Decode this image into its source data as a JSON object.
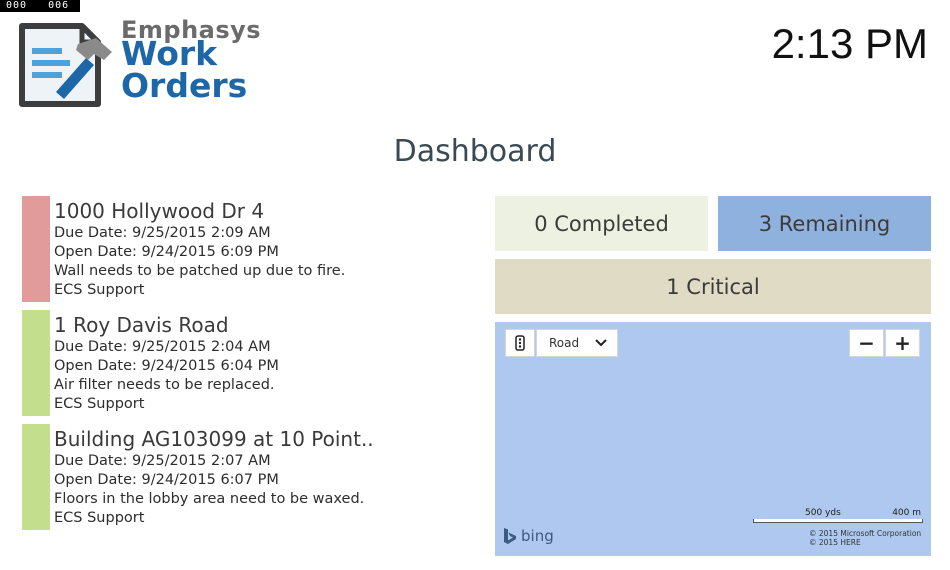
{
  "debug": {
    "left": "000",
    "right": "006"
  },
  "brand": {
    "line1": "Emphasys",
    "line2": "Work",
    "line3": "Orders"
  },
  "clock": "2:13 PM",
  "page_title": "Dashboard",
  "orders": [
    {
      "address": "1000 Hollywood Dr 4",
      "due": "Due Date: 9/25/2015 2:09 AM",
      "open": "Open Date: 9/24/2015 6:09 PM",
      "description": "Wall needs to be patched up due to fire.",
      "assignee": "ECS Support",
      "color": "#e19b9b"
    },
    {
      "address": "1 Roy Davis Road",
      "due": "Due Date: 9/25/2015 2:04 AM",
      "open": "Open Date: 9/24/2015 6:04 PM",
      "description": "Air filter needs to be replaced.",
      "assignee": "ECS Support",
      "color": "#c3de8c"
    },
    {
      "address": "Building AG103099 at 10 Point..",
      "due": "Due Date: 9/25/2015 2:07 AM",
      "open": "Open Date: 9/24/2015 6:07 PM",
      "description": "Floors in the lobby area need to be waxed.",
      "assignee": "ECS Support",
      "color": "#c3de8c"
    }
  ],
  "stats": {
    "completed": "0 Completed",
    "remaining": "3 Remaining",
    "critical": "1 Critical"
  },
  "map": {
    "style_value": "Road",
    "zoom_out": "−",
    "zoom_in": "+",
    "scale_yds": "500 yds",
    "scale_m": "400 m",
    "bing_label": "bing",
    "copyright1": "© 2015 Microsoft Corporation",
    "copyright2": "© 2015 HERE"
  },
  "colors": {
    "accent": "#1d67a8",
    "remaining_tile": "#8fb1de",
    "map_water": "#aec8ef"
  }
}
